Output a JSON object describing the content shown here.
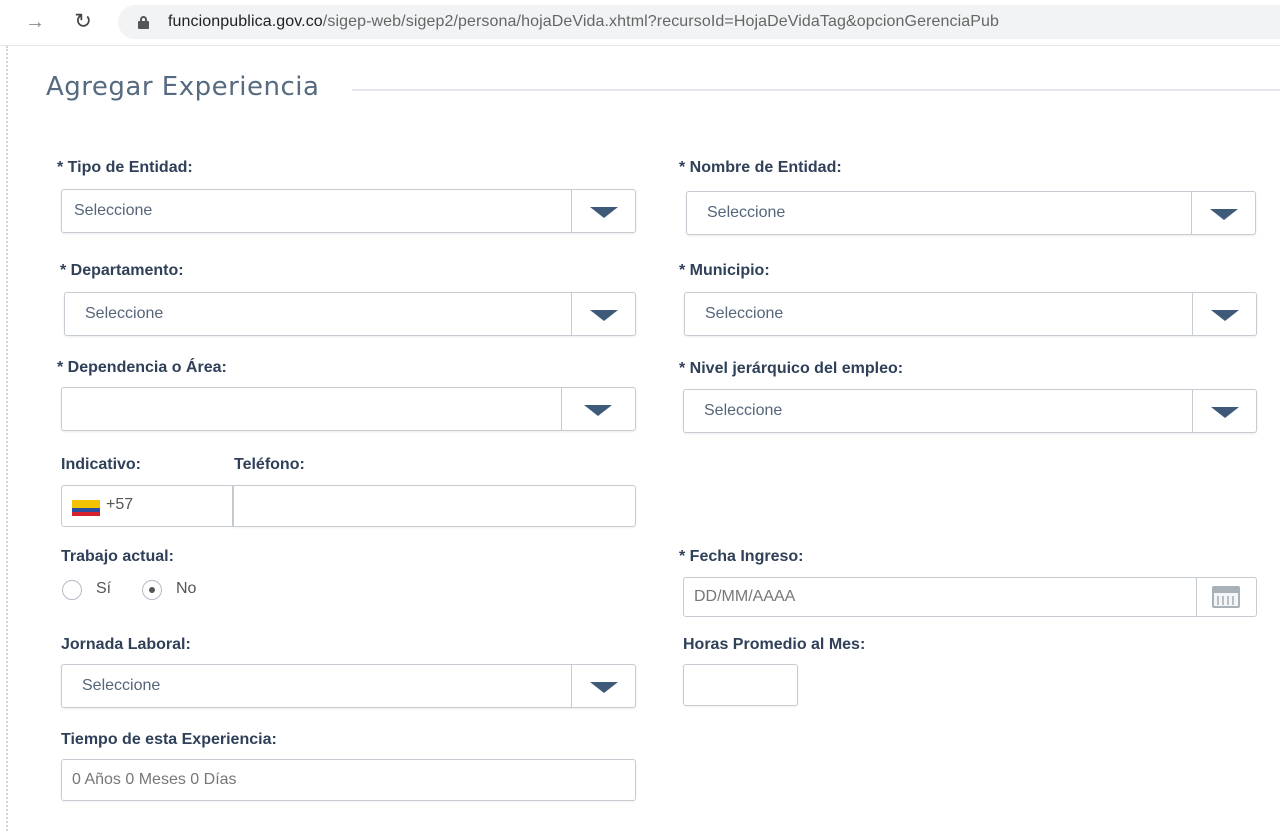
{
  "browser": {
    "url_host": "funcionpublica.gov.co",
    "url_path": "/sigep-web/sigep2/persona/hojaDeVida.xhtml?recursoId=HojaDeVidaTag&opcionGerenciaPub",
    "forward_icon": "→",
    "reload_icon": "↻"
  },
  "form": {
    "title": "Agregar Experiencia",
    "tipo_entidad": {
      "label": "* Tipo de Entidad:",
      "value": "Seleccione"
    },
    "nombre_entidad": {
      "label": "* Nombre de Entidad:",
      "value": "Seleccione"
    },
    "departamento": {
      "label": "* Departamento:",
      "value": "Seleccione"
    },
    "municipio": {
      "label": "* Municipio:",
      "value": "Seleccione"
    },
    "dependencia": {
      "label": "* Dependencia o Área:",
      "value": ""
    },
    "nivel_jerarquico": {
      "label": "* Nivel jerárquico del empleo:",
      "value": "Seleccione"
    },
    "indicativo": {
      "label": "Indicativo:",
      "value": "+57"
    },
    "telefono": {
      "label": "Teléfono:",
      "value": ""
    },
    "trabajo_actual": {
      "label": "Trabajo actual:",
      "options": [
        "Sí",
        "No"
      ],
      "selected": "No"
    },
    "fecha_ingreso": {
      "label": "* Fecha Ingreso:",
      "placeholder": "DD/MM/AAAA"
    },
    "jornada_laboral": {
      "label": "Jornada Laboral:",
      "value": "Seleccione"
    },
    "horas_promedio": {
      "label": "Horas Promedio al Mes:",
      "value": ""
    },
    "tiempo_experiencia": {
      "label": "Tiempo de esta Experiencia:",
      "value": "0 Años 0 Meses 0 Días"
    }
  },
  "colors": {
    "label": "#2f4058",
    "title": "#566a80",
    "caret": "#3e5a78",
    "border": "#c7ccd3"
  }
}
